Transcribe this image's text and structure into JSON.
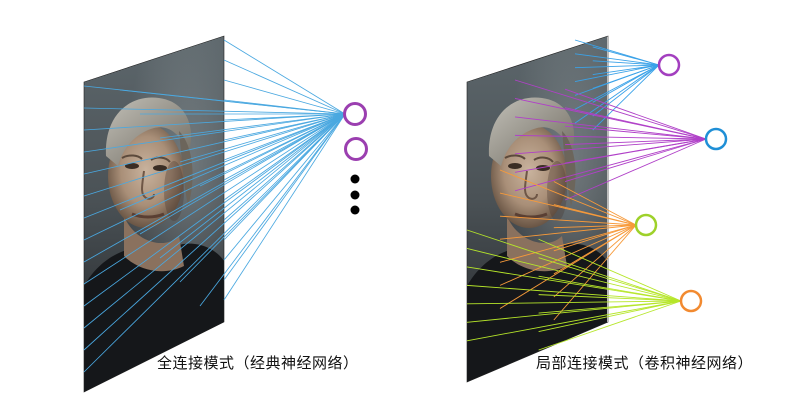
{
  "captions": {
    "fully_connected": "全连接模式（经典神经网络）",
    "locally_connected": "局部连接模式（卷积神经网络）"
  },
  "colors": {
    "fc_lines": "#4aa8e0",
    "fc_neuron": "#9b3fb0",
    "ellipsis_dots": "#000000",
    "conv_neuron_1": "#a33fbf",
    "conv_neuron_2": "#1f8fd6",
    "conv_neuron_3": "#9ed12a",
    "conv_neuron_4": "#f28a30",
    "conv_lines_1": "#3aa2e8",
    "conv_lines_2": "#b040c8",
    "conv_lines_3": "#f79a3a",
    "conv_lines_4": "#b6e62a",
    "panel_dark": "#1c1e22",
    "panel_background": "#4b5357"
  },
  "panels": [
    {
      "name": "input-image-fully-connected"
    },
    {
      "name": "input-image-locally-connected"
    }
  ],
  "fully_connected": {
    "visible_neurons": 2,
    "ellipsis": true
  },
  "locally_connected": {
    "neurons": 4,
    "receptive_fields": [
      "top-right region",
      "upper-middle region",
      "middle region",
      "lower region"
    ]
  }
}
